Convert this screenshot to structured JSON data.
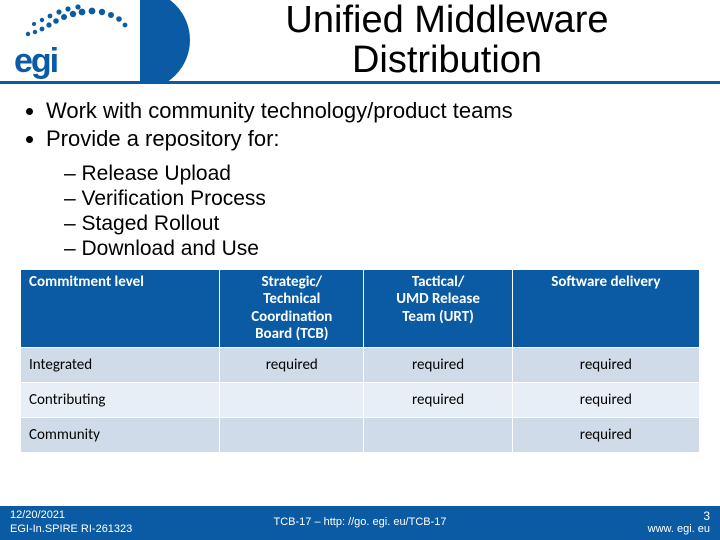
{
  "header": {
    "logo_text": "egi",
    "title_line1": "Unified Middleware",
    "title_line2": "Distribution"
  },
  "bullets": {
    "b1": "Work with community technology/product teams",
    "b2": "Provide a repository for:"
  },
  "dashes": {
    "d1": "Release Upload",
    "d2": "Verification Process",
    "d3": "Staged Rollout",
    "d4": "Download and Use"
  },
  "chart_data": {
    "type": "table",
    "columns": [
      "Commitment level",
      "Strategic/ Technical Coordination Board (TCB)",
      "Tactical/ UMD Release Team (URT)",
      "Software delivery"
    ],
    "rows": [
      {
        "level": "Integrated",
        "tcb": "required",
        "urt": "required",
        "sd": "required"
      },
      {
        "level": "Contributing",
        "tcb": "",
        "urt": "required",
        "sd": "required"
      },
      {
        "level": "Community",
        "tcb": "",
        "urt": "",
        "sd": "required"
      }
    ]
  },
  "footer": {
    "date": "12/20/2021",
    "ref": "EGI-In.SPIRE RI-261323",
    "mid": "TCB-17 – http: //go. egi. eu/TCB-17",
    "page": "3",
    "site": "www. egi. eu"
  }
}
